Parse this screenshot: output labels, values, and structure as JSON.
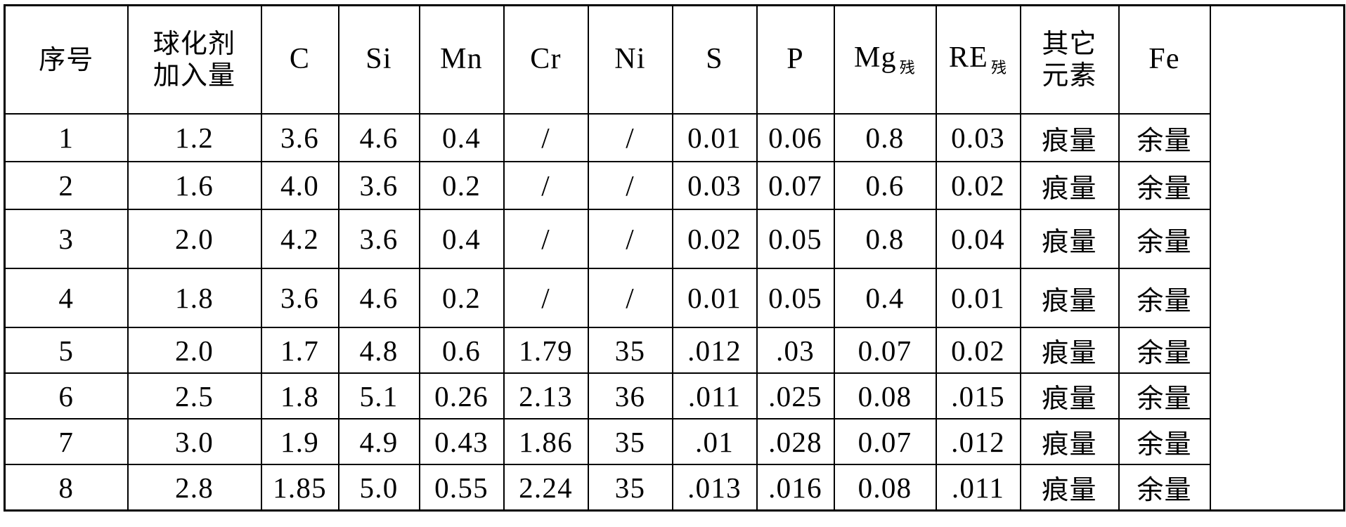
{
  "table": {
    "columns": [
      {
        "key": "seq",
        "label": "序号",
        "kind": "cjk",
        "name": "column-header-sequence"
      },
      {
        "key": "dose",
        "label_line1": "球化剂",
        "label_line2": "加入量",
        "kind": "cjk2",
        "name": "column-header-nodulizer-addition"
      },
      {
        "key": "c",
        "label": "C",
        "kind": "latin",
        "name": "column-header-c"
      },
      {
        "key": "si",
        "label": "Si",
        "kind": "latin",
        "name": "column-header-si"
      },
      {
        "key": "mn",
        "label": "Mn",
        "kind": "latin",
        "name": "column-header-mn"
      },
      {
        "key": "cr",
        "label": "Cr",
        "kind": "latin",
        "name": "column-header-cr"
      },
      {
        "key": "ni",
        "label": "Ni",
        "kind": "latin",
        "name": "column-header-ni"
      },
      {
        "key": "s",
        "label": "S",
        "kind": "latin",
        "name": "column-header-s"
      },
      {
        "key": "p",
        "label": "P",
        "kind": "latin",
        "name": "column-header-p"
      },
      {
        "key": "mg",
        "label": "Mg",
        "subscript": "残",
        "kind": "sub",
        "name": "column-header-mg-residual"
      },
      {
        "key": "re",
        "label": "RE",
        "subscript": "残",
        "kind": "sub",
        "name": "column-header-re-residual"
      },
      {
        "key": "other",
        "label_line1": "其它",
        "label_line2": "元素",
        "kind": "cjk2",
        "name": "column-header-other-elements"
      },
      {
        "key": "fe",
        "label": "Fe",
        "kind": "latin",
        "name": "column-header-fe"
      }
    ],
    "rows": [
      {
        "cells": [
          "1",
          "1.2",
          "3.6",
          "4.6",
          "0.4",
          "/",
          "/",
          "0.01",
          "0.06",
          "0.8",
          "0.03",
          "痕量",
          "余量"
        ]
      },
      {
        "cells": [
          "2",
          "1.6",
          "4.0",
          "3.6",
          "0.2",
          "/",
          "/",
          "0.03",
          "0.07",
          "0.6",
          "0.02",
          "痕量",
          "余量"
        ]
      },
      {
        "cells": [
          "3",
          "2.0",
          "4.2",
          "3.6",
          "0.4",
          "/",
          "/",
          "0.02",
          "0.05",
          "0.8",
          "0.04",
          "痕量",
          "余量"
        ]
      },
      {
        "cells": [
          "4",
          "1.8",
          "3.6",
          "4.6",
          "0.2",
          "/",
          "/",
          "0.01",
          "0.05",
          "0.4",
          "0.01",
          "痕量",
          "余量"
        ]
      },
      {
        "cells": [
          "5",
          "2.0",
          "1.7",
          "4.8",
          "0.6",
          "1.79",
          "35",
          ".012",
          ".03",
          "0.07",
          "0.02",
          "痕量",
          "余量"
        ]
      },
      {
        "cells": [
          "6",
          "2.5",
          "1.8",
          "5.1",
          "0.26",
          "2.13",
          "36",
          ".011",
          ".025",
          "0.08",
          ".015",
          "痕量",
          "余量"
        ]
      },
      {
        "cells": [
          "7",
          "3.0",
          "1.9",
          "4.9",
          "0.43",
          "1.86",
          "35",
          ".01",
          ".028",
          "0.07",
          ".012",
          "痕量",
          "余量"
        ]
      },
      {
        "cells": [
          "8",
          "2.8",
          "1.85",
          "5.0",
          "0.55",
          "2.24",
          "35",
          ".013",
          ".016",
          "0.08",
          ".011",
          "痕量",
          "余量"
        ]
      }
    ]
  },
  "style": {
    "border_color": "#000000",
    "background": "#ffffff",
    "text_color": "#000000"
  }
}
